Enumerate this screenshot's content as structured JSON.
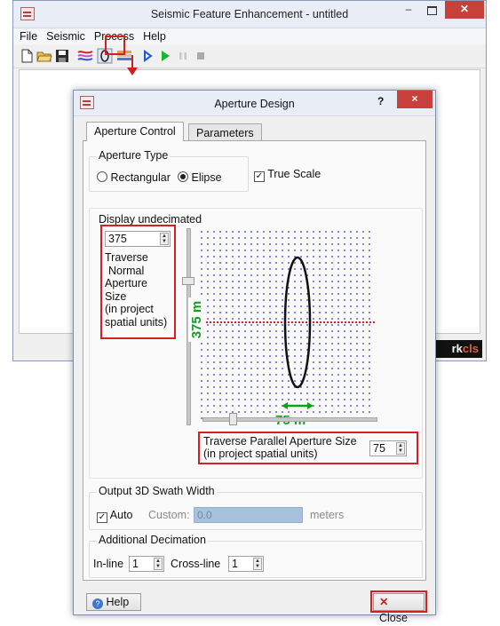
{
  "main_window": {
    "title": "Seismic Feature Enhancement - untitled",
    "menu": [
      "File",
      "Seismic",
      "Process",
      "Help"
    ],
    "logo_text_a": "rk",
    "logo_text_b": "cls"
  },
  "toolbar": {
    "icons": [
      "new-file-icon",
      "open-folder-icon",
      "save-icon",
      "seismic-color-icon",
      "aperture-design-icon",
      "horizon-icon",
      "play-blue-icon",
      "run-green-icon",
      "pause-icon",
      "stop-icon"
    ]
  },
  "dialog": {
    "title": "Aperture Design",
    "help_glyph": "?",
    "close_glyph": "×",
    "tabs": [
      "Aperture Control",
      "Parameters"
    ],
    "aperture_type": {
      "title": "Aperture Type",
      "options": [
        "Rectangular",
        "Elipse"
      ],
      "selected": "Elipse",
      "true_scale_label": "True Scale",
      "true_scale_checked": true
    },
    "display": {
      "title": "Display undecimated",
      "normal_size_value": "375",
      "normal_size_label": [
        "Traverse",
        "Normal",
        "Aperture",
        "Size",
        "(in project",
        "spatial units)"
      ],
      "vertical_dim_label": "375 m",
      "horizontal_dim_label": "75 m",
      "parallel_size_label_line1": "Traverse Parallel Aperture Size",
      "parallel_size_label_line2": "(in project spatial units)",
      "parallel_size_value": "75"
    },
    "swath": {
      "title": "Output 3D Swath Width",
      "auto_label": "Auto",
      "auto_checked": true,
      "custom_label": "Custom:",
      "custom_value": "0.0",
      "units": "meters"
    },
    "decimation": {
      "title": "Additional Decimation",
      "inline_label": "In-line",
      "inline_value": "1",
      "crossline_label": "Cross-line",
      "crossline_value": "1"
    },
    "help_button": "Help",
    "close_button": "Close"
  },
  "colors": {
    "highlight": "#d42020",
    "dimension": "#10a020",
    "grid_dot": "#3535d0",
    "center_line": "#e02020"
  }
}
